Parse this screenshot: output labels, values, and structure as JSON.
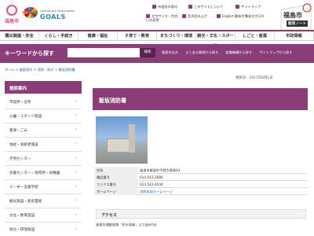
{
  "header": {
    "city_name": "福島市",
    "sdg_label": "SUSTAINABLE DEVELOPMENT",
    "sdg_goals": "GOALS",
    "top_links": [
      "市役所の案内",
      "このサイトについて",
      "サイトマップ"
    ],
    "util_links": [
      "文字サイズ・色合いの変更",
      "音声読み上げ",
      "English",
      "簡体字",
      "繁体字",
      "한국어"
    ]
  },
  "nav": {
    "items": [
      "震災関連・安全",
      "くらし・手続き",
      "健康・福祉",
      "子育て・教育",
      "まちづくり・環境",
      "観光・文化・スポーツ",
      "しごと・産業",
      "市政情報"
    ]
  },
  "search": {
    "title": "キーワードから探す",
    "placeholder": "",
    "button": "検索",
    "links": [
      "検索の仕方",
      "よくある質問から探す",
      "組織機構から探す",
      "サイトマップから探す"
    ]
  },
  "breadcrumb": "ホーム > 施設案内 > 消防・防災 > 飯坂消防署",
  "sidebar": {
    "title": "施設案内",
    "items": [
      "市役所・支所",
      "公園・スポーツ施設",
      "資源・ごみ",
      "福祉・高齢者施設",
      "学習センター",
      "児童センター・保育所・幼稚園",
      "小・中・支援学校",
      "観光施設・歴史遺産",
      "文化・教育施設",
      "防災・環境施設"
    ]
  },
  "main": {
    "date": "更新日：2017年8月1日",
    "title": "飯坂消防署",
    "info": [
      {
        "k": "住所",
        "v": "福島市飯坂町平野字東原43"
      },
      {
        "k": "電話番号",
        "v": "024-542-2086"
      },
      {
        "k": "ファクス番号",
        "v": "024-542-6544"
      },
      {
        "k": "ホームページ",
        "v": "消防本部ホームページ"
      }
    ],
    "access_title": "アクセス",
    "access_text": "福島交通飯坂線「花水坂駅」より徒歩5分"
  },
  "badge": {
    "city": "福島市",
    "sub": "販売ノート"
  },
  "colors": {
    "primary": "#8a3d78",
    "primary_dark": "#5a2250",
    "link": "#1a5fa0"
  }
}
